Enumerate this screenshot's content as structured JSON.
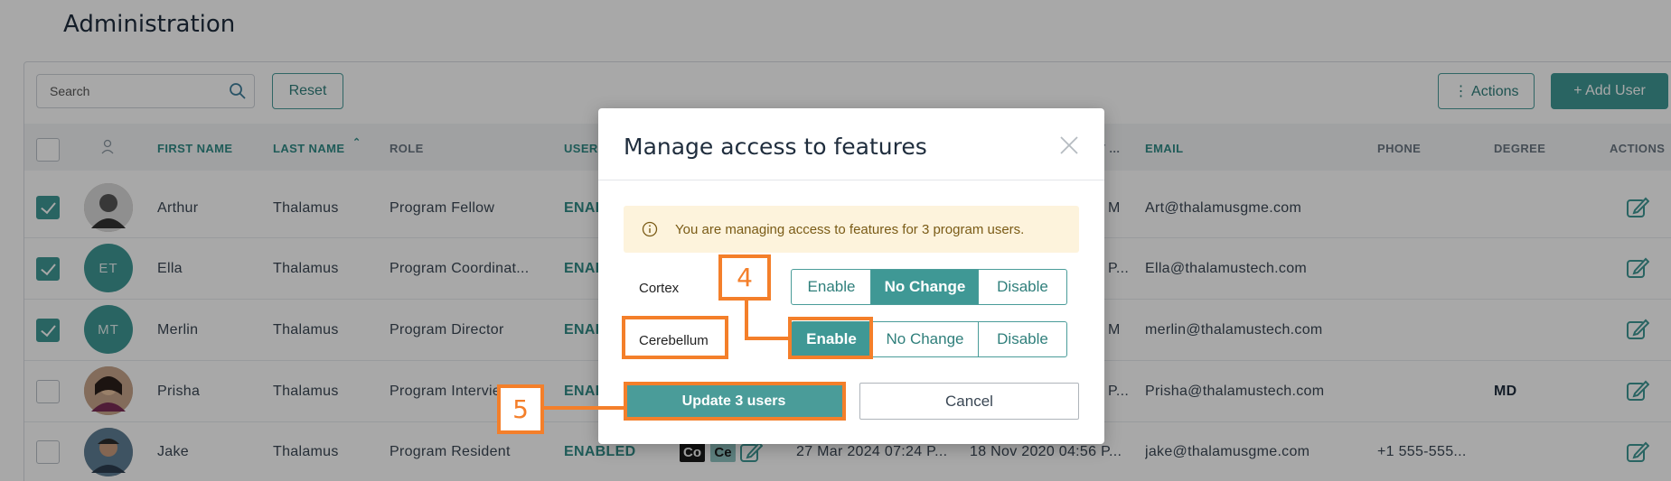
{
  "page": {
    "title": "Administration"
  },
  "toolbar": {
    "search_placeholder": "Search",
    "reset_label": "Reset",
    "actions_label": "⋮ Actions",
    "add_user_label": "+ Add User"
  },
  "table": {
    "headers": [
      "FIRST NAME",
      "LAST NAME",
      "ROLE",
      "USER",
      "EMAIL",
      "PHONE",
      "DEGREE",
      "ACTIONS"
    ],
    "sort_indicator": "⌃",
    "tags": [
      "Co",
      "Ce"
    ],
    "rows": [
      {
        "initials": "",
        "first": "Arthur",
        "last": "Thalamus",
        "role": "Program Fellow",
        "status": "ENABLED",
        "date_frag": "M",
        "email": "Art@thalamusgme.com",
        "phone": "",
        "degree": "",
        "checked": true
      },
      {
        "initials": "ET",
        "first": "Ella",
        "last": "Thalamus",
        "role": "Program Coordinat...",
        "status": "ENABLED",
        "date_frag": "P...",
        "email": "Ella@thalamustech.com",
        "phone": "",
        "degree": "",
        "checked": true
      },
      {
        "initials": "MT",
        "first": "Merlin",
        "last": "Thalamus",
        "role": "Program Director",
        "status": "ENABLED",
        "date_frag": "M",
        "email": "merlin@thalamustech.com",
        "phone": "",
        "degree": "",
        "checked": true
      },
      {
        "initials": "",
        "first": "Prisha",
        "last": "Thalamus",
        "role": "Program Interviewer",
        "status": "ENABLED",
        "date_frag": "P...",
        "email": "Prisha@thalamustech.com",
        "phone": "",
        "degree": "MD",
        "checked": false
      },
      {
        "initials": "",
        "first": "Jake",
        "last": "Thalamus",
        "role": "Program Resident",
        "status": "ENABLED",
        "date1": "27 Mar 2024 07:24 P...",
        "date2": "18 Nov 2020 04:56 P...",
        "email": "jake@thalamusgme.com",
        "phone": "+1 555-555...",
        "degree": "",
        "checked": false
      }
    ],
    "hidden_header_frag": "T ..."
  },
  "modal": {
    "title": "Manage access to features",
    "notice": "You are managing access to features for 3 program users.",
    "features": [
      {
        "name": "Cortex",
        "selected": "No Change"
      },
      {
        "name": "Cerebellum",
        "selected": "Enable"
      }
    ],
    "options": [
      "Enable",
      "No Change",
      "Disable"
    ],
    "update_label": "Update 3 users",
    "cancel_label": "Cancel"
  },
  "annotations": {
    "step4": "4",
    "step5": "5",
    "color": "#f47f2a"
  },
  "colors": {
    "accent": "#3f9895",
    "notice_bg": "#fdf3dc"
  }
}
